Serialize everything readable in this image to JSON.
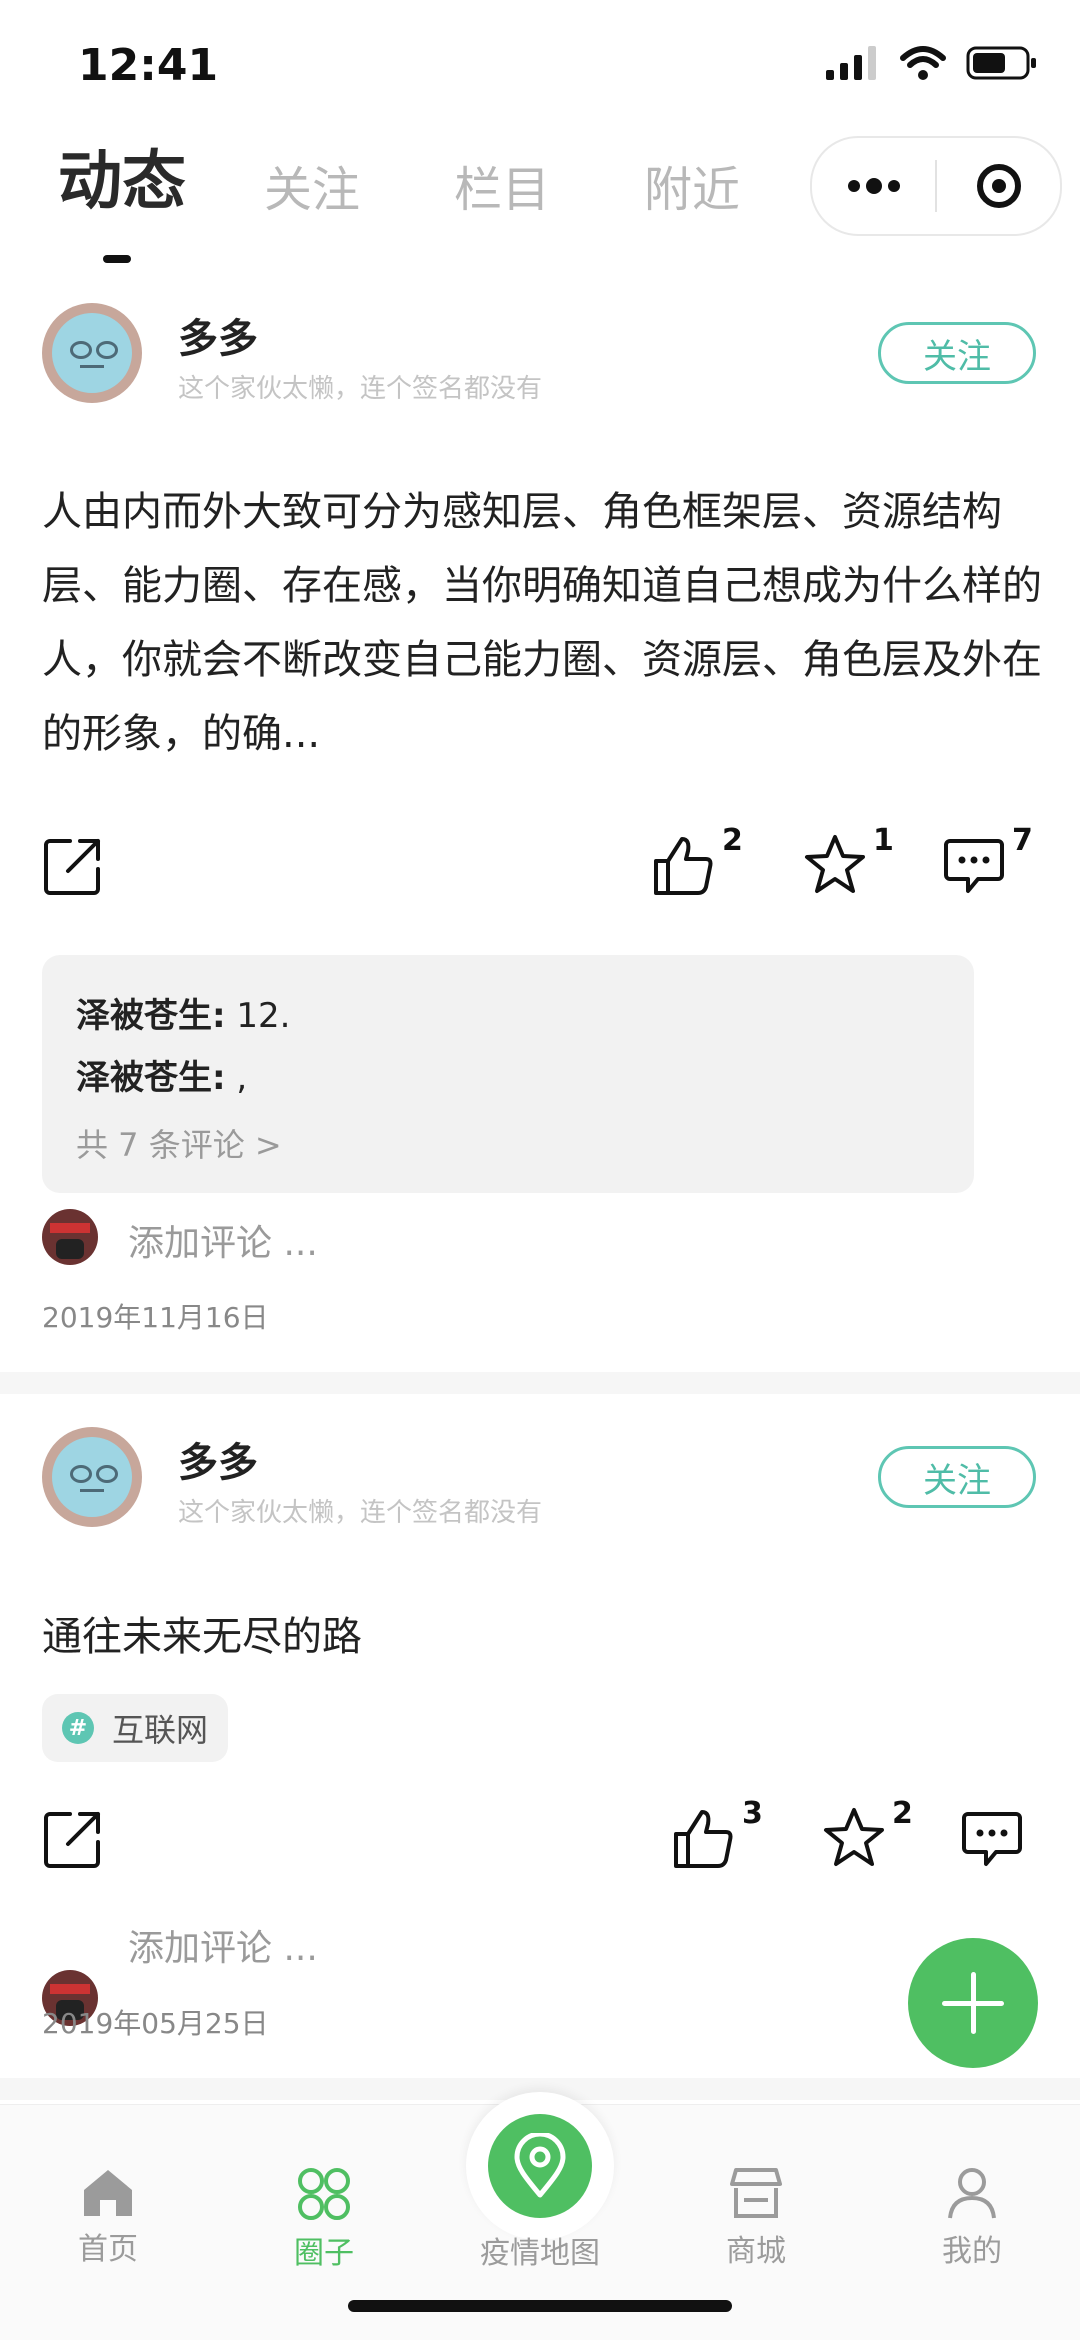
{
  "status_bar": {
    "time": "12:41"
  },
  "tabs": [
    {
      "label": "动态",
      "active": true
    },
    {
      "label": "关注",
      "active": false
    },
    {
      "label": "栏目",
      "active": false
    },
    {
      "label": "附近",
      "active": false
    }
  ],
  "capsule": {
    "more_icon": "more-dots-icon",
    "close_icon": "record-circle-icon"
  },
  "posts": [
    {
      "author": "多多",
      "signature": "这个家伙太懒，连个签名都没有",
      "follow_label": "关注",
      "text": "人由内而外大致可分为感知层、角色框架层、资源结构层、能力圈、存在感，当你明确知道自己想成为什么样的人，你就会不断改变自己能力圈、资源层、角色层及外在的形象，的确...",
      "likes": "2",
      "favorites": "1",
      "comments": "7",
      "comment_preview": [
        {
          "user": "泽被苍生:",
          "content": " 12."
        },
        {
          "user": "泽被苍生:",
          "content": " ,"
        }
      ],
      "more_comments": "共 7 条评论 >",
      "add_comment": "添加评论 ...",
      "date": "2019年11月16日"
    },
    {
      "author": "多多",
      "signature": "这个家伙太懒，连个签名都没有",
      "follow_label": "关注",
      "text": "通往未来无尽的路",
      "tag": "互联网",
      "likes": "3",
      "favorites": "2",
      "add_comment": "添加评论 ...",
      "date": "2019年05月25日"
    }
  ],
  "bottom_nav": [
    {
      "label": "首页",
      "icon": "home-icon",
      "active": false
    },
    {
      "label": "圈子",
      "icon": "circles-icon",
      "active": true
    },
    {
      "label": "疫情地图",
      "icon": "map-pin-icon",
      "active": false
    },
    {
      "label": "商城",
      "icon": "store-icon",
      "active": false
    },
    {
      "label": "我的",
      "icon": "user-icon",
      "active": false
    }
  ],
  "colors": {
    "accent_green": "#4fbf62",
    "follow_teal": "#5ec6b3",
    "text_dark": "#222222",
    "muted": "#9a9a9a"
  }
}
